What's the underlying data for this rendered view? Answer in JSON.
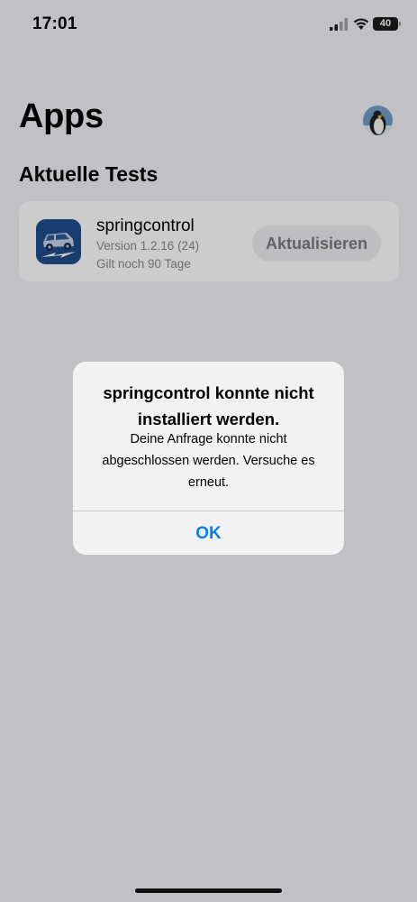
{
  "status_bar": {
    "time": "17:01",
    "battery": "40"
  },
  "header": {
    "title": "Apps",
    "section": "Aktuelle Tests"
  },
  "app": {
    "name": "springcontrol",
    "version": "Version 1.2.16 (24)",
    "expiry": "Gilt noch 90 Tage",
    "update_label": "Aktualisieren"
  },
  "alert": {
    "title": "springcontrol konnte nicht installiert werden.",
    "message": "Deine Anfrage konnte nicht abgeschlossen werden. Versuche es erneut.",
    "ok_label": "OK"
  },
  "colors": {
    "accent": "#0a7cf0",
    "background": "#f2f2f7",
    "app_icon": "#1f4d8a"
  }
}
